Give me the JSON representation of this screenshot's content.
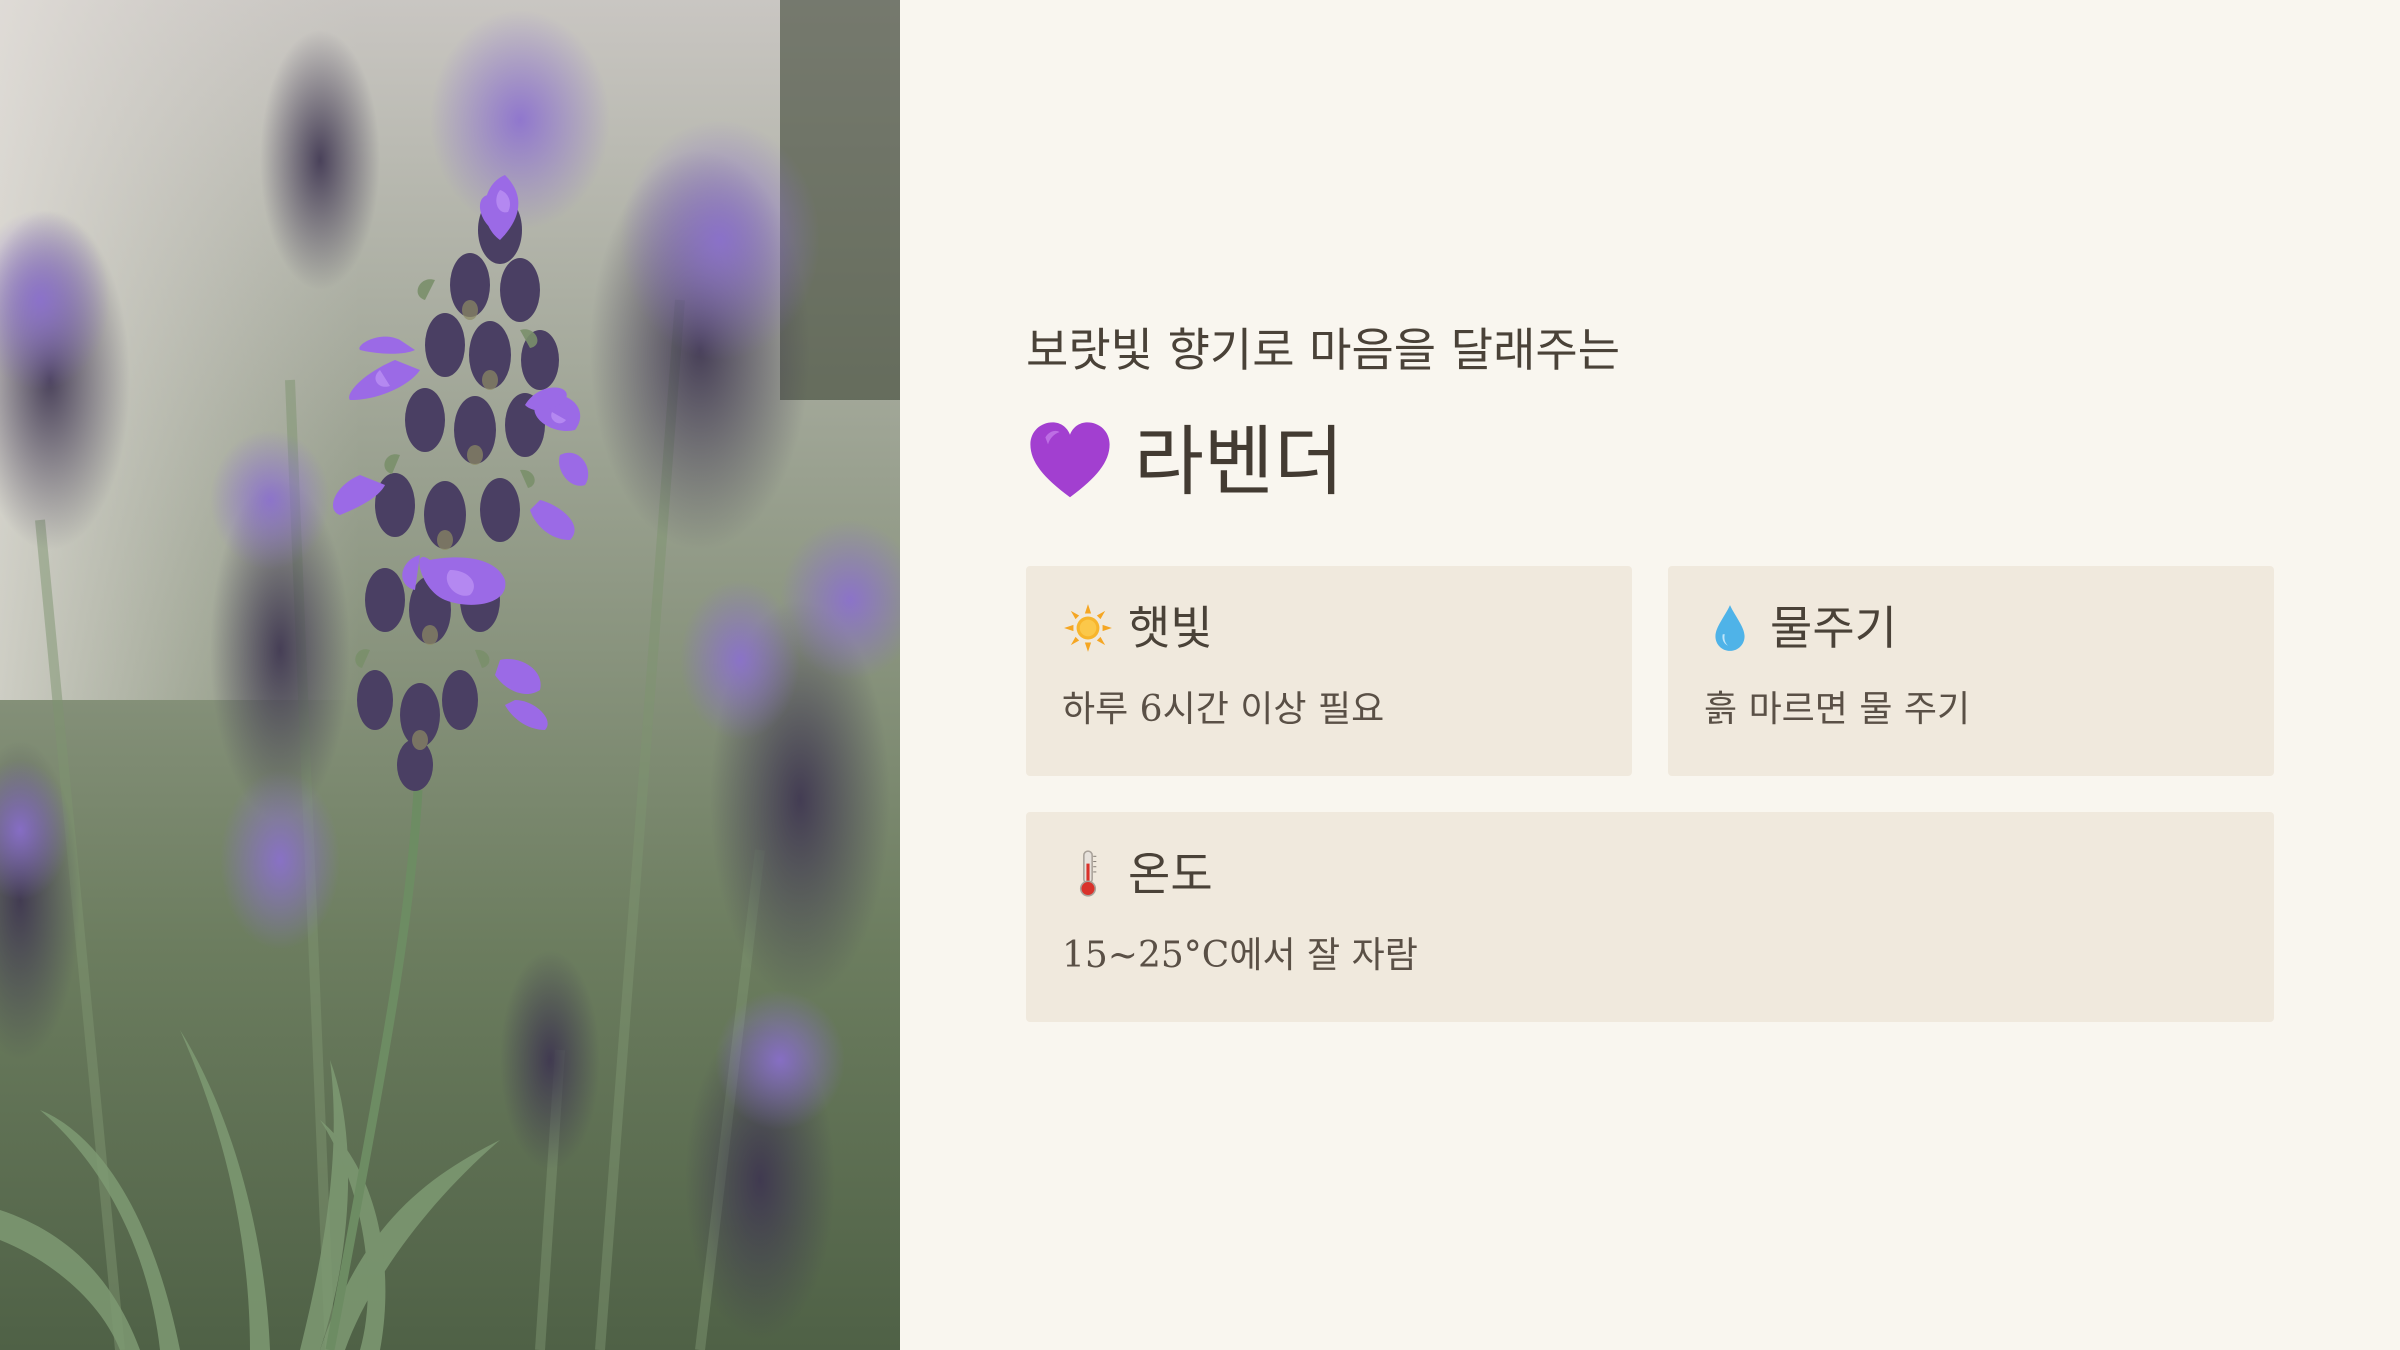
{
  "header": {
    "subtitle": "보랏빛 향기로 마음을 달래주는",
    "title": "라벤더",
    "title_icon": "purple-heart-icon"
  },
  "cards": {
    "sun": {
      "icon": "sun-icon",
      "title": "햇빛",
      "desc": "하루 6시간 이상 필요"
    },
    "water": {
      "icon": "water-drop-icon",
      "title": "물주기",
      "desc": "흙 마르면 물 주기"
    },
    "temp": {
      "icon": "thermometer-icon",
      "title": "온도",
      "desc": "15~25°C에서 잘 자람"
    }
  },
  "colors": {
    "background": "#f9f6ef",
    "card": "#f0e9dd",
    "text": "#4a4238",
    "accent": "#a23fd0"
  }
}
